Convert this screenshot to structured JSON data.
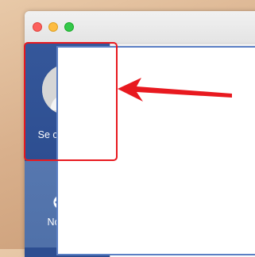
{
  "sidebar": {
    "connect_label": "Se connecter",
    "new_label": "Nouveau"
  },
  "colors": {
    "sidebar": "#5f80b8",
    "sidebar_active": "#2d4e91",
    "highlight": "#e8191f",
    "canvas_border": "#5b7fc4"
  },
  "icons": {
    "avatar": "user-avatar-icon",
    "new": "new-document-icon",
    "arrow": "arrow-left-icon"
  }
}
